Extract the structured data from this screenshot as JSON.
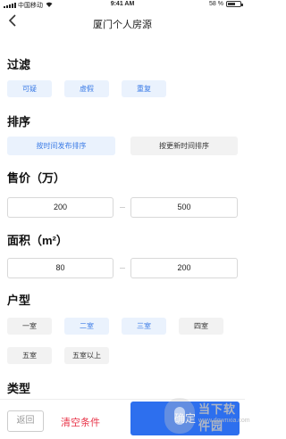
{
  "status_bar": {
    "carrier": "中国移动",
    "time": "9:41 AM",
    "battery": "58 %"
  },
  "nav": {
    "back_icon": "chevron-left-icon",
    "title": "厦门个人房源"
  },
  "filter": {
    "title": "过滤",
    "options": [
      {
        "label": "可疑",
        "selected": true
      },
      {
        "label": "虚假",
        "selected": true
      },
      {
        "label": "重复",
        "selected": true
      }
    ]
  },
  "sort": {
    "title": "排序",
    "options": [
      {
        "label": "按时间发布排序",
        "selected": true
      },
      {
        "label": "按更新时间排序",
        "selected": false
      }
    ]
  },
  "price": {
    "title": "售价（万）",
    "min": "200",
    "max": "500"
  },
  "area": {
    "title": "面积（m²）",
    "min": "80",
    "max": "200"
  },
  "layout": {
    "title": "户型",
    "options": [
      {
        "label": "一室",
        "selected": false
      },
      {
        "label": "二室",
        "selected": true
      },
      {
        "label": "三室",
        "selected": true
      },
      {
        "label": "四室",
        "selected": false
      },
      {
        "label": "五室",
        "selected": false
      },
      {
        "label": "五室以上",
        "selected": false
      }
    ]
  },
  "type": {
    "title": "类型"
  },
  "bottom": {
    "back_label": "返回",
    "clear_label": "清空条件",
    "confirm_label": "确定"
  },
  "watermark": {
    "text": "当下软件园",
    "url": "www.downxia.com"
  },
  "colors": {
    "accent": "#2d6fee",
    "chip_selected_bg": "#eaf2fd",
    "chip_selected_text": "#3c7ce6",
    "chip_bg": "#f2f2f2",
    "clear_text": "#e8364a"
  }
}
